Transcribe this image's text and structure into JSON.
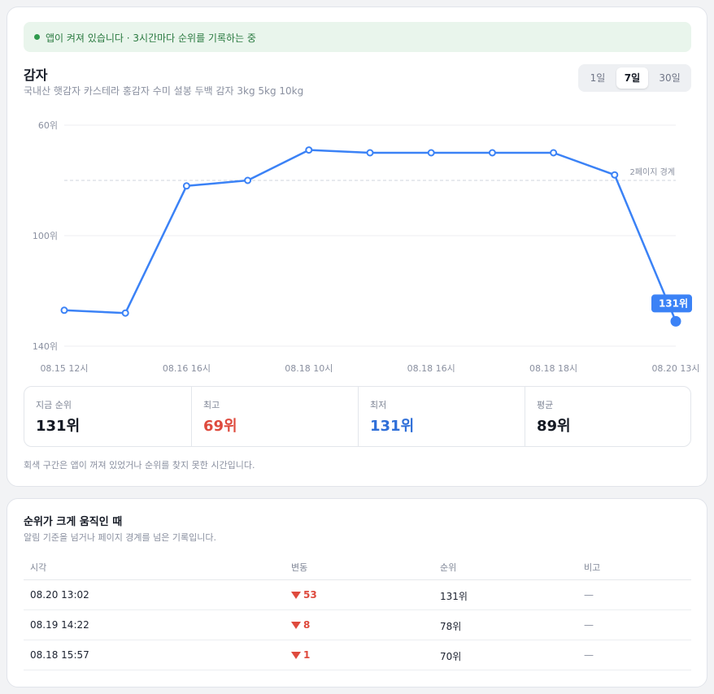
{
  "status": {
    "text": "앱이 켜져 있습니다 · 3시간마다 순위를 기록하는 중"
  },
  "product": {
    "title": "감자",
    "subtitle": "국내산 햇감자 카스테라 홍감자 수미 설봉 두백 감자 3kg 5kg 10kg"
  },
  "range_tabs": [
    {
      "label": "1일",
      "active": false
    },
    {
      "label": "7일",
      "active": true
    },
    {
      "label": "30일",
      "active": false
    }
  ],
  "chart_data": {
    "type": "line",
    "y_axis_ticks": [
      "60위",
      "100위",
      "140위"
    ],
    "ylim": [
      60,
      140
    ],
    "y_inverted": true,
    "x_tick_labels": [
      "08.15 12시",
      "08.16 16시",
      "08.18 10시",
      "08.18 16시",
      "08.18 18시",
      "08.20 13시"
    ],
    "series": [
      {
        "values": [
          127,
          128,
          82,
          80,
          69,
          70,
          70,
          70,
          70,
          78,
          131
        ]
      }
    ],
    "reference_line": {
      "value": 80,
      "label": "2페이지 경계"
    },
    "current_badge": "131위",
    "grid": true,
    "colors": {
      "line": "#3b82f6",
      "point_fill": "#ffffff",
      "grid": "#eceef2",
      "reference": "#cfd4dc"
    }
  },
  "stats": [
    {
      "label": "지금 순위",
      "value": "131위",
      "color": "#141923"
    },
    {
      "label": "최고",
      "value": "69위",
      "color": "#de4a3d"
    },
    {
      "label": "최저",
      "value": "131위",
      "color": "#2f6fd8"
    },
    {
      "label": "평균",
      "value": "89위",
      "color": "#141923"
    }
  ],
  "note": "회색 구간은 앱이 꺼져 있었거나 순위를 찾지 못한 시간입니다.",
  "moves": {
    "title": "순위가 크게 움직인 때",
    "subtitle": "알림 기준을 넘거나 페이지 경계를 넘은 기록입니다.",
    "columns": [
      "시각",
      "변동",
      "순위",
      "비고"
    ],
    "rows": [
      {
        "time": "08.20 13:02",
        "delta": "53",
        "rank": "131위",
        "note": "—"
      },
      {
        "time": "08.19 14:22",
        "delta": "8",
        "rank": "78위",
        "note": "—"
      },
      {
        "time": "08.18 15:57",
        "delta": "1",
        "rank": "70위",
        "note": "—"
      }
    ]
  }
}
